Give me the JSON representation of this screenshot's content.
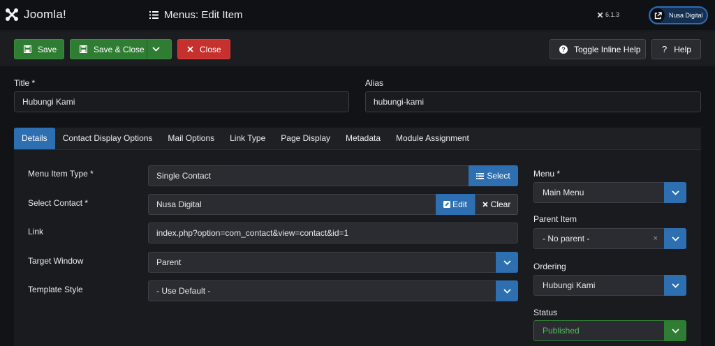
{
  "header": {
    "logo_text": "Joomla!",
    "page_title": "Menus: Edit Item",
    "version": "6.1.3",
    "site_name": "Nusa Digital"
  },
  "toolbar": {
    "save": "Save",
    "save_close": "Save & Close",
    "close": "Close",
    "toggle_help": "Toggle Inline Help",
    "help": "Help"
  },
  "form": {
    "title_label": "Title *",
    "title_value": "Hubungi Kami",
    "alias_label": "Alias",
    "alias_value": "hubungi-kami"
  },
  "tabs": [
    "Details",
    "Contact Display Options",
    "Mail Options",
    "Link Type",
    "Page Display",
    "Metadata",
    "Module Assignment"
  ],
  "details": {
    "menu_item_type_label": "Menu Item Type *",
    "menu_item_type_value": "Single Contact",
    "select_btn": "Select",
    "select_contact_label": "Select Contact *",
    "select_contact_value": "Nusa Digital",
    "edit_btn": "Edit",
    "clear_btn": "Clear",
    "link_label": "Link",
    "link_value": "index.php?option=com_contact&view=contact&id=1",
    "target_window_label": "Target Window",
    "target_window_value": "Parent",
    "template_style_label": "Template Style",
    "template_style_value": "- Use Default -"
  },
  "sidebar": {
    "menu_label": "Menu *",
    "menu_value": "Main Menu",
    "parent_label": "Parent Item",
    "parent_value": "- No parent -",
    "ordering_label": "Ordering",
    "ordering_value": "Hubungi Kami",
    "status_label": "Status",
    "status_value": "Published"
  },
  "colors": {
    "primary": "#2d6fb0",
    "success": "#2f7d32",
    "danger": "#c6302d",
    "published_text": "#5cb85c"
  }
}
